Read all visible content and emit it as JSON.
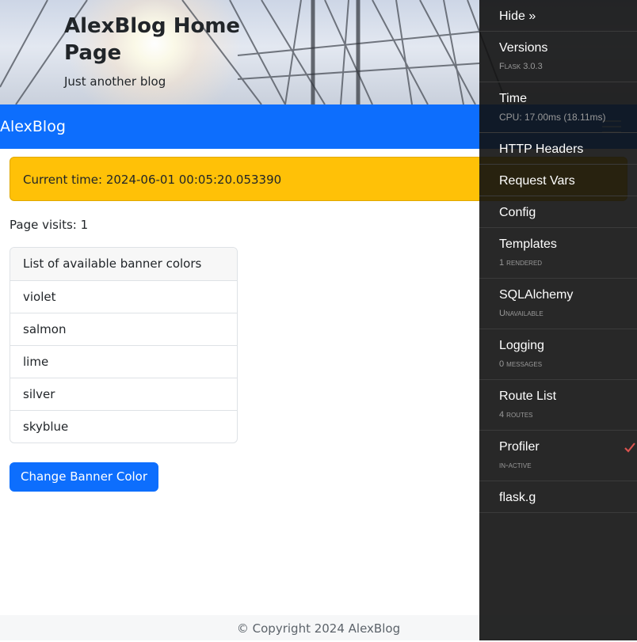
{
  "header": {
    "title": "AlexBlog Home Page",
    "subtitle": "Just another blog"
  },
  "navbar": {
    "brand": "AlexBlog"
  },
  "alert": {
    "text": "Current time: 2024-06-01 00:05:20.053390"
  },
  "page_visits": "Page visits: 1",
  "banner_list": {
    "header": "List of available banner colors",
    "items": [
      "violet",
      "salmon",
      "lime",
      "silver",
      "skyblue"
    ]
  },
  "change_button_label": "Change Banner Color",
  "footer": {
    "text": "© Copyright 2024 AlexBlog"
  },
  "colors": {
    "navbar": "#0d6efd",
    "alert": "#ffc107",
    "toolbar": "#111111",
    "check": "#d9534f"
  },
  "debug_toolbar": {
    "hide": "Hide »",
    "panels": [
      {
        "title": "Versions",
        "sub": "Flask 3.0.3"
      },
      {
        "title": "Time",
        "sub": "CPU: 17.00ms (18.11ms)"
      },
      {
        "title": "HTTP Headers"
      },
      {
        "title": "Request Vars"
      },
      {
        "title": "Config"
      },
      {
        "title": "Templates",
        "sub": "1 rendered"
      },
      {
        "title": "SQLAlchemy",
        "sub": "Unavailable"
      },
      {
        "title": "Logging",
        "sub": "0 messages"
      },
      {
        "title": "Route List",
        "sub": "4 routes"
      },
      {
        "title": "Profiler",
        "sub": "in-active",
        "icon": "checkmark-icon"
      },
      {
        "title": "flask.g"
      }
    ]
  }
}
